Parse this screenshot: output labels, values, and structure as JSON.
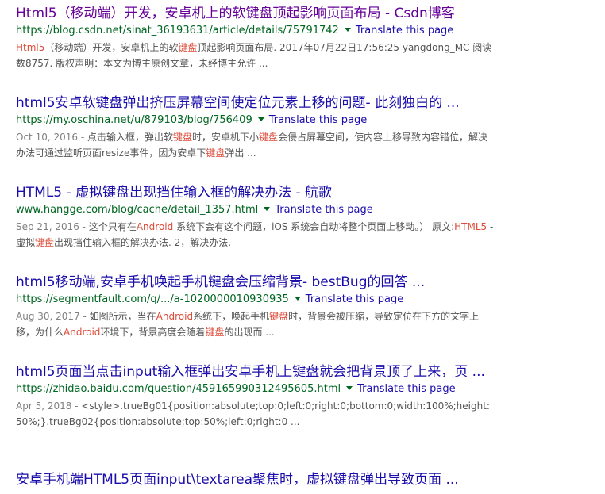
{
  "translate_label": "Translate this page",
  "results": [
    {
      "title": "Html5（移动端）开发，安卓机上的软键盘顶起影响页面布局 - Csdn博客",
      "url": "https://blog.csdn.net/sinat_36193631/article/details/75791742",
      "snippet": {
        "date": "",
        "parts": [
          {
            "t": "Html5",
            "hl": true
          },
          {
            "t": "（移动端）开发，安卓机上的软",
            "hl": false
          },
          {
            "t": "键盘",
            "hl": true
          },
          {
            "t": "顶起影响页面布局. 2017年07月22日17:56:25 yangdong_MC 阅读数8757. 版权声明：本文为博主原创文章，未经博主允许 ...",
            "hl": false
          }
        ]
      }
    },
    {
      "title": "html5安卓软键盘弹出挤压屏幕空间使定位元素上移的问题- 此刻独白的 ...",
      "url": "https://my.oschina.net/u/879103/blog/756409",
      "snippet": {
        "date": "Oct 10, 2016 - ",
        "parts": [
          {
            "t": "点击输入框，弹出软",
            "hl": false
          },
          {
            "t": "键盘",
            "hl": true
          },
          {
            "t": "时，安卓机下小",
            "hl": false
          },
          {
            "t": "键盘",
            "hl": true
          },
          {
            "t": "会侵占屏幕空间，使内容上移导致内容错位，解决办法可通过监听页面resize事件，因为安卓下",
            "hl": false
          },
          {
            "t": "键盘",
            "hl": true
          },
          {
            "t": "弹出 ...",
            "hl": false
          }
        ]
      }
    },
    {
      "title": "HTML5 - 虚拟键盘出现挡住输入框的解决办法 - 航歌",
      "url": "www.hangge.com/blog/cache/detail_1357.html",
      "snippet": {
        "date": "Sep 21, 2016 - ",
        "parts": [
          {
            "t": "这个只有在",
            "hl": false
          },
          {
            "t": "Android",
            "hl": true
          },
          {
            "t": " 系统下会有这个问题，iOS 系统会自动将整个页面上移动。） 原文:",
            "hl": false
          },
          {
            "t": "HTML5",
            "hl": true
          },
          {
            "t": " - 虚拟",
            "hl": false
          },
          {
            "t": "键盘",
            "hl": true
          },
          {
            "t": "出现挡住输入框的解决办法. 2，解决办法.",
            "hl": false
          }
        ]
      }
    },
    {
      "title": "html5移动端,安卓手机唤起手机键盘会压缩背景- bestBug的回答 ...",
      "url": "https://segmentfault.com/q/.../a-1020000010930935",
      "snippet": {
        "date": "Aug 30, 2017 - ",
        "parts": [
          {
            "t": "如图所示，当在",
            "hl": false
          },
          {
            "t": "Android",
            "hl": true
          },
          {
            "t": "系统下，唤起手机",
            "hl": false
          },
          {
            "t": "键盘",
            "hl": true
          },
          {
            "t": "时，背景会被压缩，导致定位在下方的文字上移，为什么",
            "hl": false
          },
          {
            "t": "Android",
            "hl": true
          },
          {
            "t": "环境下，背景高度会随着",
            "hl": false
          },
          {
            "t": "键盘",
            "hl": true
          },
          {
            "t": "的出现而 ...",
            "hl": false
          }
        ]
      }
    },
    {
      "title": "html5页面当点击input输入框弹出安卓手机上键盘就会把背景顶了上来，页 ...",
      "url": "https://zhidao.baidu.com/question/459165990312495605.html",
      "snippet": {
        "date": "Apr 5, 2018 - ",
        "parts": [
          {
            "t": "<style>.trueBg01{position:absolute;top:0;left:0;right:0;bottom:0;width:100%;height:50%;}.trueBg02{position:absolute;top:50%;left:0;right:0 ...",
            "hl": false
          }
        ]
      }
    },
    {
      "title": "安卓手机端HTML5页面input\\textarea聚焦时，虚拟键盘弹出导致页面 ...",
      "url": "",
      "snippet": {
        "date": "",
        "parts": []
      }
    }
  ]
}
